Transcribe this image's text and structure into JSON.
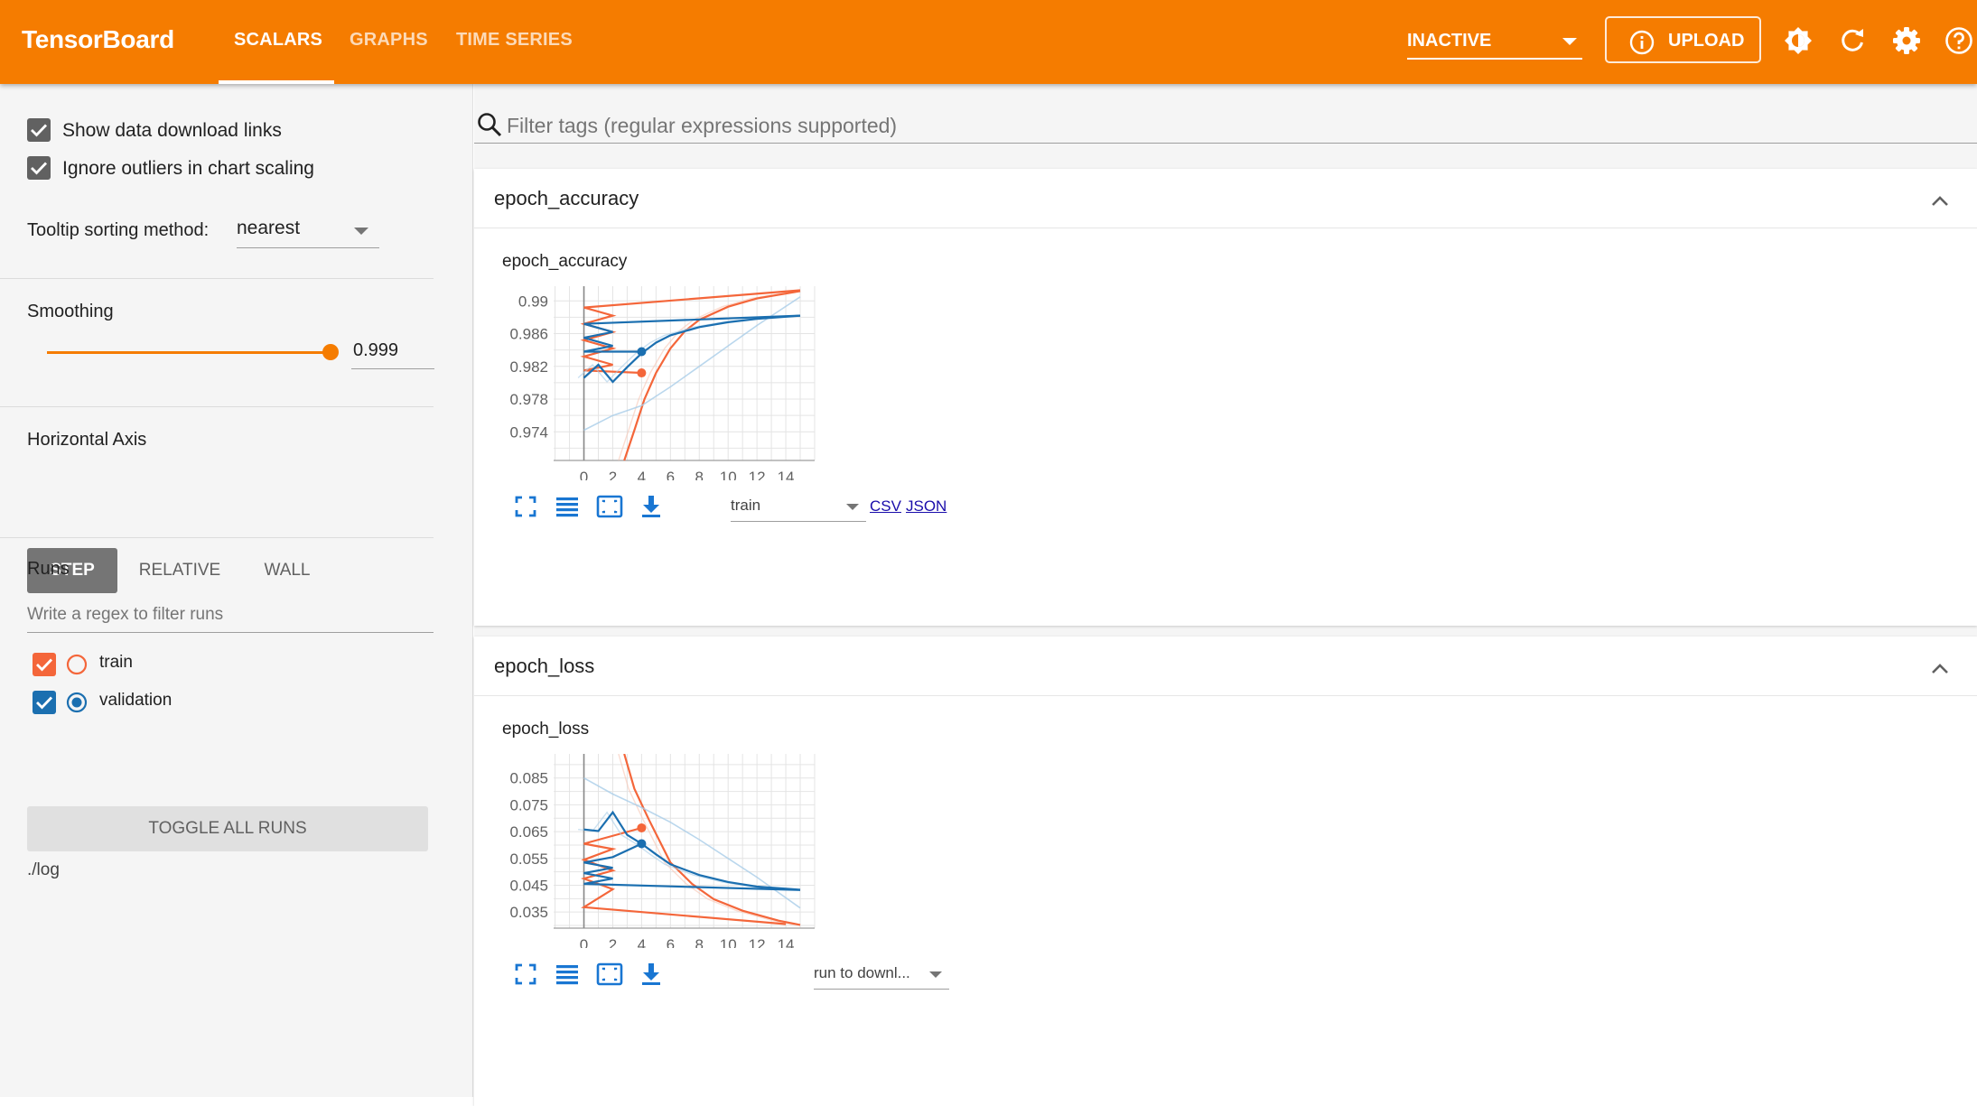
{
  "app": {
    "brand": "TensorBoard",
    "tabs": [
      {
        "label": "SCALARS",
        "active": true
      },
      {
        "label": "GRAPHS",
        "active": false
      },
      {
        "label": "TIME SERIES",
        "active": false
      }
    ],
    "status_select": "INACTIVE",
    "upload_label": "UPLOAD",
    "colors": {
      "topbar": "#f57c00",
      "train": "#f4663a",
      "validation": "#1b6fb0"
    }
  },
  "sidebar": {
    "show_download_links": {
      "label": "Show data download links",
      "checked": true
    },
    "ignore_outliers": {
      "label": "Ignore outliers in chart scaling",
      "checked": true
    },
    "tooltip_sorting": {
      "label": "Tooltip sorting method:",
      "value": "nearest"
    },
    "smoothing": {
      "label": "Smoothing",
      "value": "0.999",
      "level": 0.999
    },
    "horizontal_axis": {
      "label": "Horizontal Axis",
      "options": [
        "STEP",
        "RELATIVE",
        "WALL"
      ],
      "selected": "STEP"
    },
    "runs": {
      "label": "Runs",
      "filter_placeholder": "Write a regex to filter runs",
      "items": [
        {
          "name": "train",
          "checked": true,
          "color": "#f4663a"
        },
        {
          "name": "validation",
          "checked": true,
          "color": "#1b6fb0"
        }
      ],
      "toggle_all_label": "TOGGLE ALL RUNS",
      "log_dir": "./log"
    }
  },
  "main": {
    "filter_placeholder": "Filter tags (regular expressions supported)",
    "cards": [
      {
        "title": "epoch_accuracy",
        "chart_title": "epoch_accuracy",
        "run_select": "train",
        "links": [
          "CSV",
          "JSON"
        ]
      },
      {
        "title": "epoch_loss",
        "chart_title": "epoch_loss",
        "run_select": "run to downl...",
        "links": []
      }
    ]
  },
  "chart_data": [
    {
      "type": "line",
      "title": "epoch_accuracy",
      "xlim": [
        -2.1,
        16
      ],
      "ylim": [
        0.9705,
        0.9918
      ],
      "x_ticks": [
        0,
        2,
        4,
        6,
        8,
        10,
        12,
        14
      ],
      "y_ticks": [
        0.974,
        0.978,
        0.982,
        0.986,
        0.99
      ],
      "y_tick_labels": [
        "0.974",
        "0.978",
        "0.982",
        "0.986",
        "0.99"
      ],
      "series": [
        {
          "name": "train",
          "color": "#f4663a",
          "smoothed_points": [
            [
              15,
              0.9913
            ],
            [
              0,
              0.9892
            ],
            [
              2,
              0.9882
            ],
            [
              0,
              0.9872
            ],
            [
              2,
              0.9862
            ],
            [
              0,
              0.9852
            ],
            [
              2,
              0.9842
            ],
            [
              0,
              0.9832
            ],
            [
              2,
              0.9822
            ],
            [
              0,
              0.9815
            ],
            [
              4,
              0.9812
            ]
          ],
          "highlight_point": [
            4,
            0.9812
          ],
          "curve_points": [
            [
              2.8,
              0.9705
            ],
            [
              3.5,
              0.9742
            ],
            [
              4.2,
              0.978
            ],
            [
              5,
              0.9812
            ],
            [
              6,
              0.9842
            ],
            [
              7,
              0.9863
            ],
            [
              8,
              0.9877
            ],
            [
              10,
              0.9893
            ],
            [
              12,
              0.9903
            ],
            [
              15,
              0.9912
            ]
          ]
        },
        {
          "name": "validation",
          "color": "#1b6fb0",
          "smoothed_points": [
            [
              15,
              0.9882
            ],
            [
              0,
              0.9872
            ],
            [
              2,
              0.9862
            ],
            [
              0,
              0.9855
            ],
            [
              2,
              0.9845
            ],
            [
              0,
              0.9838
            ],
            [
              4,
              0.9838
            ]
          ],
          "highlight_point": [
            4,
            0.9838
          ],
          "curve_points": [
            [
              0,
              0.9806
            ],
            [
              1,
              0.9822
            ],
            [
              2,
              0.9801
            ],
            [
              3,
              0.9819
            ],
            [
              4,
              0.9836
            ],
            [
              5,
              0.9849
            ],
            [
              6,
              0.9858
            ],
            [
              8,
              0.9868
            ],
            [
              10,
              0.9874
            ],
            [
              12,
              0.9878
            ],
            [
              15,
              0.9882
            ]
          ],
          "faint_points": [
            [
              0,
              0.9742
            ],
            [
              2,
              0.976
            ],
            [
              4,
              0.9772
            ],
            [
              6,
              0.9795
            ],
            [
              8,
              0.982
            ],
            [
              10,
              0.9845
            ],
            [
              12,
              0.987
            ],
            [
              15,
              0.9905
            ]
          ]
        }
      ]
    },
    {
      "type": "line",
      "title": "epoch_loss",
      "xlim": [
        -2.1,
        16
      ],
      "ylim": [
        0.029,
        0.094
      ],
      "x_ticks": [
        0,
        2,
        4,
        6,
        8,
        10,
        12,
        14
      ],
      "y_ticks": [
        0.035,
        0.045,
        0.055,
        0.065,
        0.075,
        0.085
      ],
      "y_tick_labels": [
        "0.035",
        "0.045",
        "0.055",
        "0.065",
        "0.075",
        "0.085"
      ],
      "series": [
        {
          "name": "train",
          "color": "#f4663a",
          "smoothed_points": [
            [
              14,
              0.0305
            ],
            [
              0,
              0.0368
            ],
            [
              2,
              0.0435
            ],
            [
              0,
              0.0475
            ],
            [
              2,
              0.0505
            ],
            [
              0,
              0.0545
            ],
            [
              2,
              0.0585
            ],
            [
              0,
              0.0605
            ],
            [
              4,
              0.0664
            ]
          ],
          "highlight_point": [
            4,
            0.0664
          ],
          "curve_points": [
            [
              2.8,
              0.094
            ],
            [
              3.5,
              0.081
            ],
            [
              4.5,
              0.0695
            ],
            [
              6,
              0.0535
            ],
            [
              7.5,
              0.0455
            ],
            [
              9,
              0.0398
            ],
            [
              11,
              0.0355
            ],
            [
              13.5,
              0.0318
            ],
            [
              15,
              0.0302
            ]
          ]
        },
        {
          "name": "validation",
          "color": "#1b6fb0",
          "smoothed_points": [
            [
              15,
              0.0432
            ],
            [
              0,
              0.0455
            ],
            [
              2,
              0.0475
            ],
            [
              0,
              0.0495
            ],
            [
              2,
              0.0515
            ],
            [
              0,
              0.0535
            ],
            [
              2,
              0.0555
            ],
            [
              4,
              0.0605
            ]
          ],
          "highlight_point": [
            4,
            0.0605
          ],
          "curve_points": [
            [
              0,
              0.0658
            ],
            [
              1,
              0.0652
            ],
            [
              2,
              0.0722
            ],
            [
              3,
              0.0638
            ],
            [
              4,
              0.0605
            ],
            [
              5,
              0.0565
            ],
            [
              6,
              0.0528
            ],
            [
              8,
              0.0488
            ],
            [
              10,
              0.0462
            ],
            [
              12,
              0.0445
            ],
            [
              15,
              0.0433
            ]
          ],
          "faint_points": [
            [
              0,
              0.085
            ],
            [
              2,
              0.079
            ],
            [
              4,
              0.074
            ],
            [
              6,
              0.0685
            ],
            [
              8,
              0.062
            ],
            [
              10,
              0.055
            ],
            [
              12,
              0.048
            ],
            [
              15,
              0.0365
            ]
          ]
        }
      ]
    }
  ]
}
